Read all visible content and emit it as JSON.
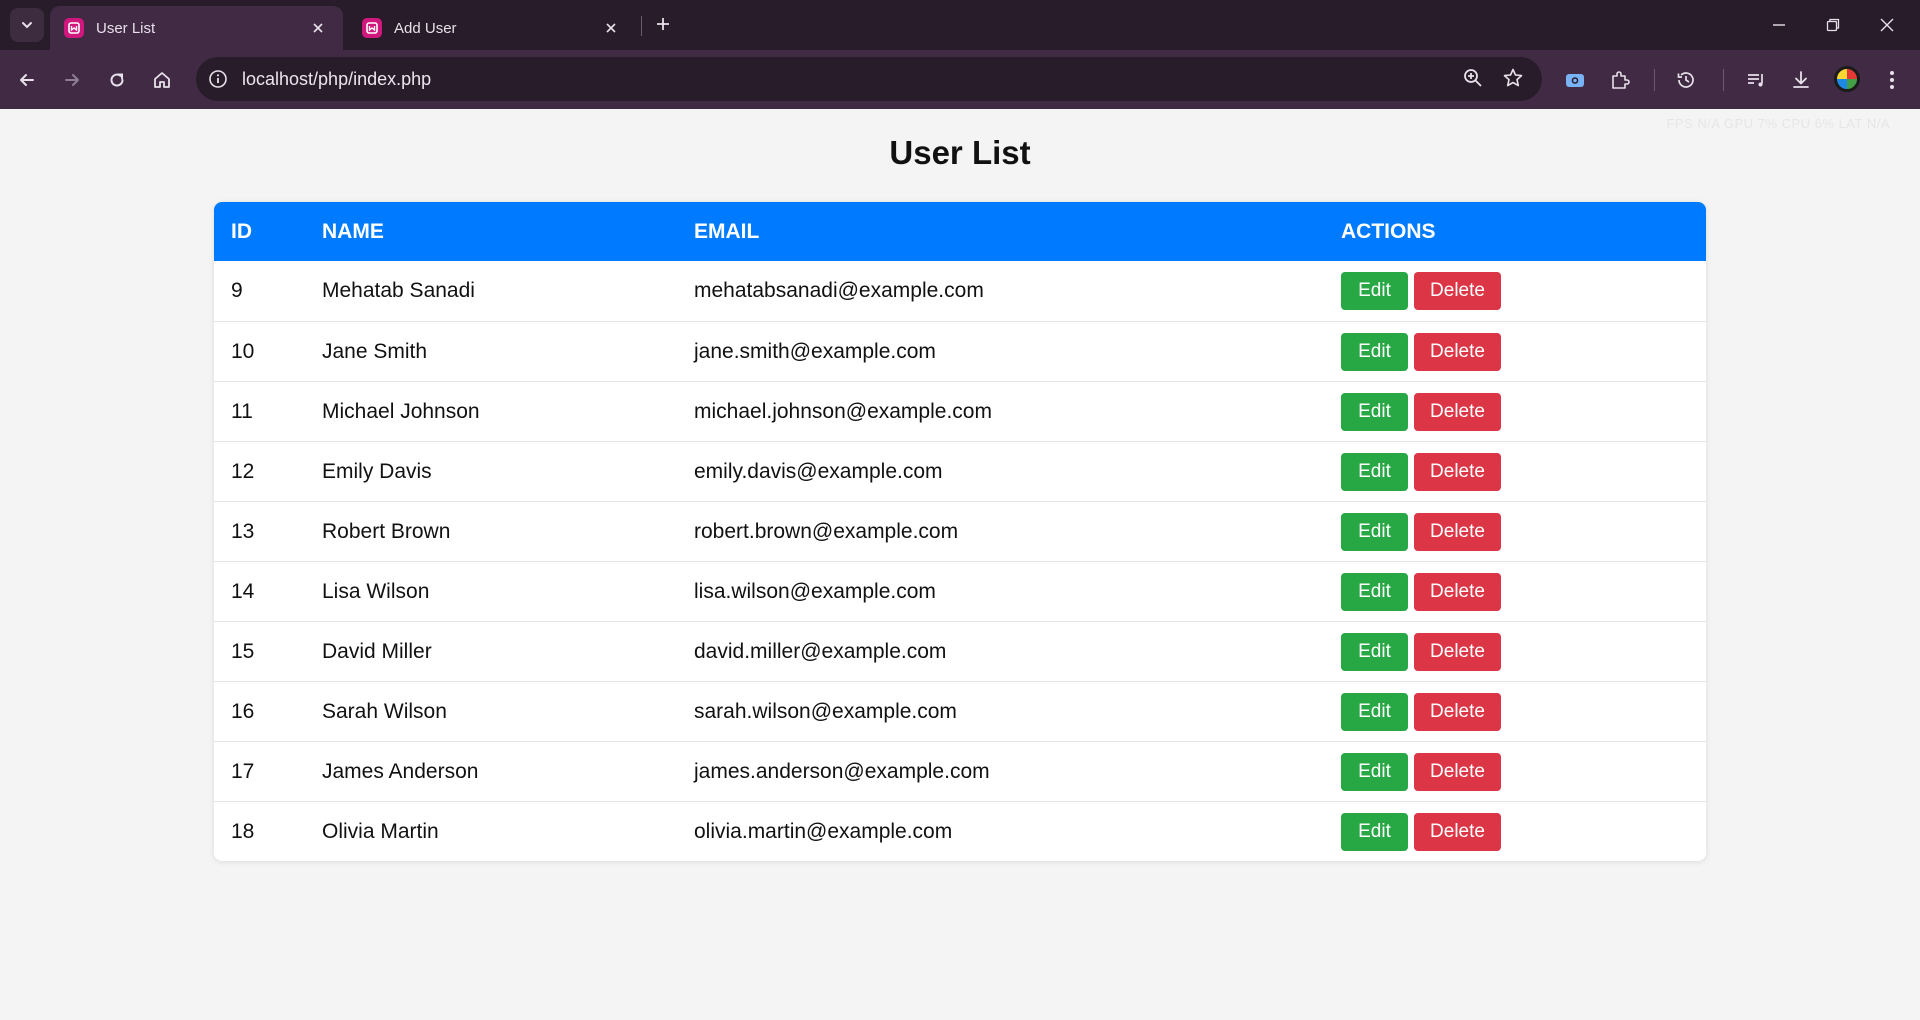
{
  "browser": {
    "tabs": [
      {
        "title": "User List",
        "active": true
      },
      {
        "title": "Add User",
        "active": false
      }
    ],
    "url": "localhost/php/index.php",
    "perf_overlay": "FPS N/A GPU 7% CPU 6% LAT N/A"
  },
  "page": {
    "title": "User List",
    "columns": [
      "ID",
      "NAME",
      "EMAIL",
      "ACTIONS"
    ],
    "edit_label": "Edit",
    "delete_label": "Delete",
    "users": [
      {
        "id": "9",
        "name": "Mehatab Sanadi",
        "email": "mehatabsanadi@example.com"
      },
      {
        "id": "10",
        "name": "Jane Smith",
        "email": "jane.smith@example.com"
      },
      {
        "id": "11",
        "name": "Michael Johnson",
        "email": "michael.johnson@example.com"
      },
      {
        "id": "12",
        "name": "Emily Davis",
        "email": "emily.davis@example.com"
      },
      {
        "id": "13",
        "name": "Robert Brown",
        "email": "robert.brown@example.com"
      },
      {
        "id": "14",
        "name": "Lisa Wilson",
        "email": "lisa.wilson@example.com"
      },
      {
        "id": "15",
        "name": "David Miller",
        "email": "david.miller@example.com"
      },
      {
        "id": "16",
        "name": "Sarah Wilson",
        "email": "sarah.wilson@example.com"
      },
      {
        "id": "17",
        "name": "James Anderson",
        "email": "james.anderson@example.com"
      },
      {
        "id": "18",
        "name": "Olivia Martin",
        "email": "olivia.martin@example.com"
      }
    ]
  },
  "colors": {
    "header_bg": "#007bff",
    "edit_button": "#28a745",
    "delete_button": "#dc3545",
    "page_bg": "#f4f4f4",
    "chrome_tabbar": "#281b2a",
    "chrome_toolbar": "#402a44"
  },
  "icons": {
    "tab_search": "chevron-down-icon",
    "tab_favicon": "app-favicon-icon",
    "tab_close": "close-icon",
    "new_tab": "plus-icon",
    "back": "arrow-left-icon",
    "forward": "arrow-right-icon",
    "reload": "reload-icon",
    "home": "home-icon",
    "site_info": "info-icon",
    "zoom": "zoom-icon",
    "bookmark": "star-icon",
    "extensions": "puzzle-icon",
    "history": "history-icon",
    "media": "media-queue-icon",
    "downloads": "download-icon",
    "menu": "kebab-menu-icon"
  }
}
